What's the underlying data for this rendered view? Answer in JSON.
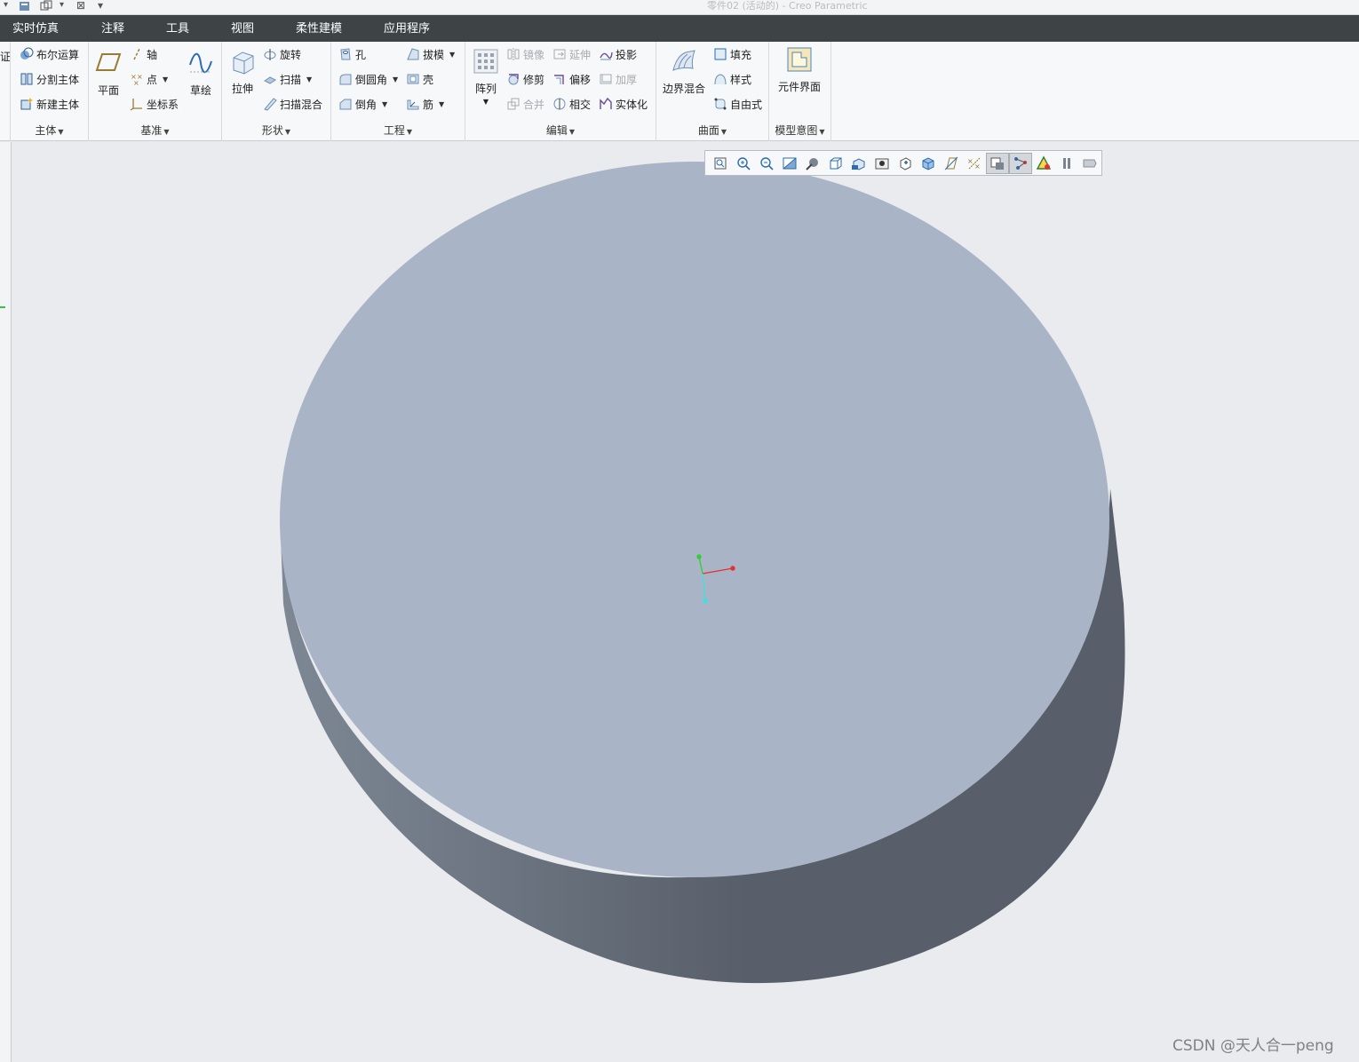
{
  "window": {
    "title": "零件02 (活动的) - Creo Parametric",
    "close_glyph": "⊠",
    "more_glyph": "▾"
  },
  "tabs": [
    "实时仿真",
    "注释",
    "工具",
    "视图",
    "柔性建模",
    "应用程序"
  ],
  "ribbon": {
    "partial_left_label": "证",
    "groups": {
      "body": {
        "label": "主体",
        "items": [
          "布尔运算",
          "分割主体",
          "新建主体"
        ]
      },
      "datum": {
        "label": "基准",
        "plane": "平面",
        "axis": "轴",
        "point": "点",
        "csys": "坐标系",
        "sketch": "草绘"
      },
      "shapes": {
        "label": "形状",
        "extrude": "拉伸",
        "revolve": "旋转",
        "sweep": "扫描",
        "swept_blend": "扫描混合"
      },
      "engineering": {
        "label": "工程",
        "hole": "孔",
        "draft": "拔模",
        "round": "倒圆角",
        "shell": "壳",
        "chamfer": "倒角",
        "rib": "筋"
      },
      "editing": {
        "label": "编辑",
        "pattern": "阵列",
        "mirror": "镜像",
        "extend": "延伸",
        "project": "投影",
        "trim": "修剪",
        "offset": "偏移",
        "thicken": "加厚",
        "merge": "合并",
        "intersect": "相交",
        "solidify": "实体化"
      },
      "surfaces": {
        "label": "曲面",
        "boundary_blend": "边界混合",
        "fill": "填充",
        "style": "样式",
        "freestyle": "自由式"
      },
      "model_intent": {
        "label": "模型意图",
        "component_interface": "元件界面"
      }
    }
  },
  "view_toolbar": {
    "buttons": [
      {
        "icon": "refit-icon",
        "active": false
      },
      {
        "icon": "zoom-in-icon",
        "active": false
      },
      {
        "icon": "zoom-out-icon",
        "active": false
      },
      {
        "icon": "repaint-icon",
        "active": false
      },
      {
        "icon": "display-style-icon",
        "active": false
      },
      {
        "icon": "saved-orientations-icon",
        "active": false
      },
      {
        "icon": "view-manager-icon",
        "active": false
      },
      {
        "icon": "perspective-icon",
        "active": false
      },
      {
        "icon": "spin-center-icon",
        "active": false
      },
      {
        "icon": "named-views-icon",
        "active": false
      },
      {
        "icon": "datum-planes-icon",
        "active": false
      },
      {
        "icon": "datum-display-filters-icon",
        "active": false
      },
      {
        "icon": "annotation-display-icon",
        "active": true
      },
      {
        "icon": "selection-filter-icon",
        "active": true
      },
      {
        "icon": "appearance-icon",
        "active": false
      },
      {
        "icon": "pause-icon",
        "active": false
      },
      {
        "icon": "stop-icon",
        "active": false
      }
    ]
  },
  "model": {
    "top_face_color": "#a9b5c6",
    "side_light_color": "#7e8895",
    "side_dark_color": "#585f6a",
    "csys_x_color": "#e33030",
    "csys_y_color": "#2fd02f",
    "csys_z_color": "#3ee0e0"
  },
  "watermark": "CSDN @天人合一peng"
}
